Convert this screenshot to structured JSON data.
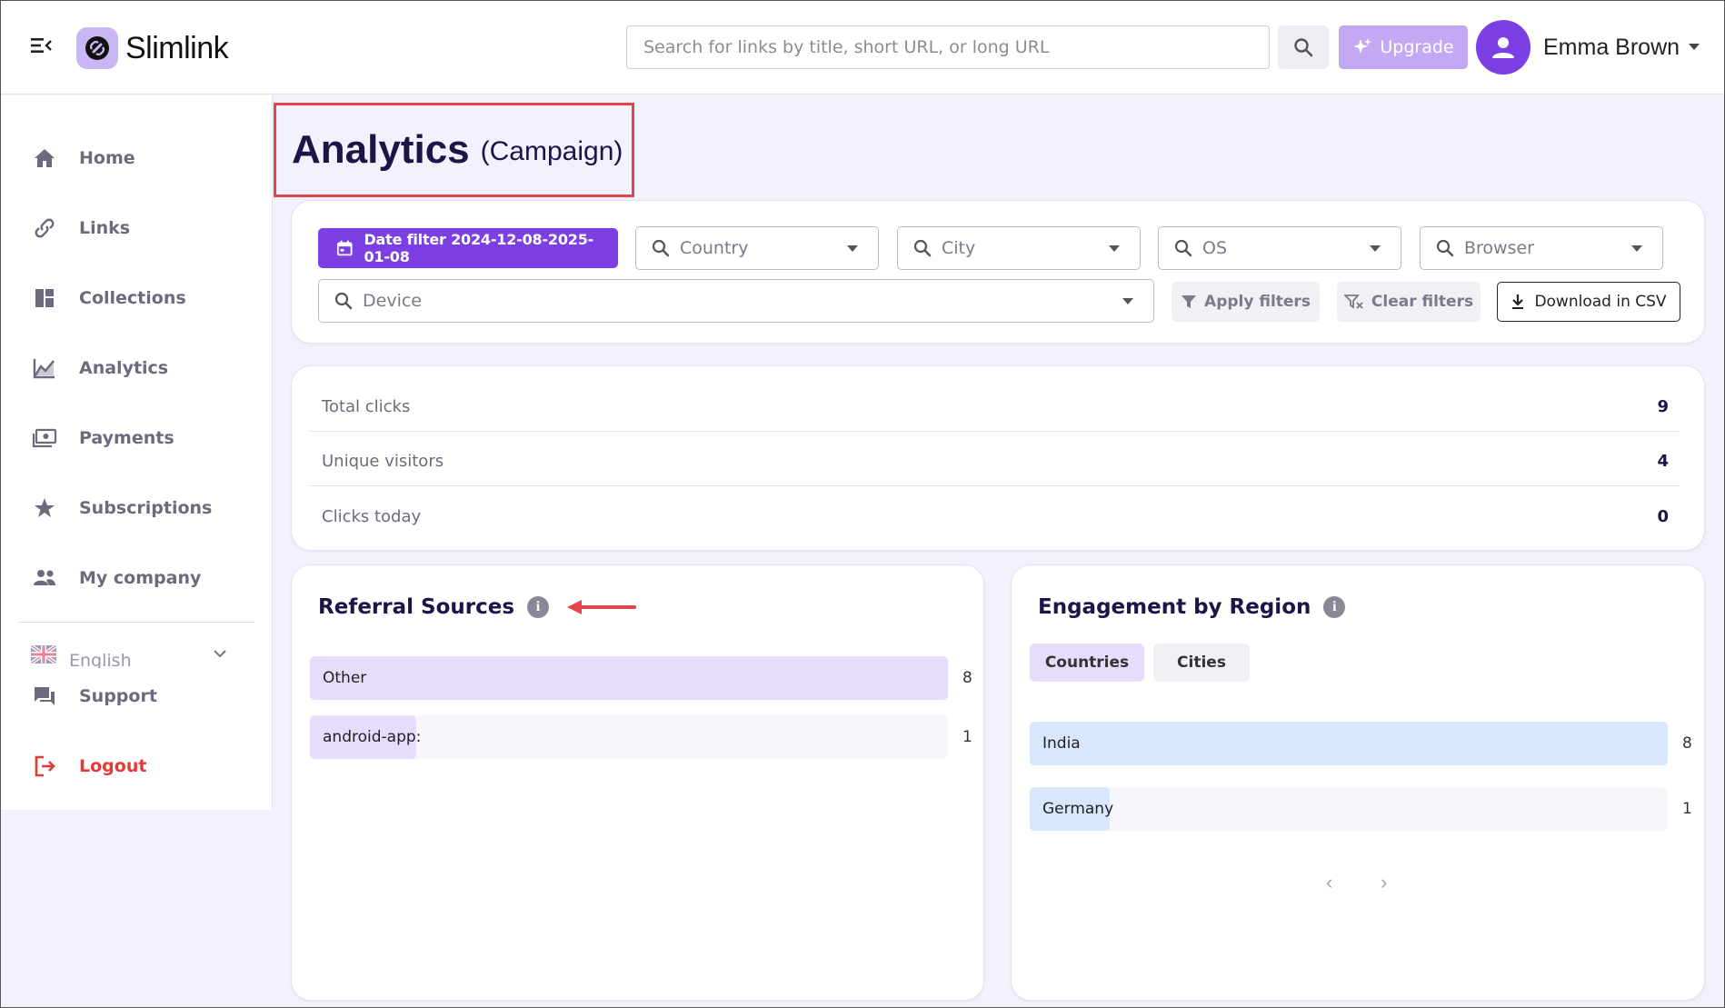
{
  "header": {
    "logo_text": "Slimlink",
    "search_placeholder": "Search for links by title, short URL, or long URL",
    "upgrade_label": "Upgrade",
    "user_name": "Emma Brown"
  },
  "sidebar": {
    "items": [
      {
        "label": "Home",
        "icon": "home-icon"
      },
      {
        "label": "Links",
        "icon": "link-icon"
      },
      {
        "label": "Collections",
        "icon": "dashboard-icon"
      },
      {
        "label": "Analytics",
        "icon": "chart-icon"
      },
      {
        "label": "Payments",
        "icon": "payments-icon"
      },
      {
        "label": "Subscriptions",
        "icon": "star-icon"
      },
      {
        "label": "My company",
        "icon": "people-icon"
      }
    ],
    "language": "English",
    "support_label": "Support",
    "logout_label": "Logout"
  },
  "page": {
    "title": "Analytics",
    "subtitle": "(Campaign)"
  },
  "filters": {
    "date_filter_label": "Date filter 2024-12-08-2025-01-08",
    "country_placeholder": "Country",
    "city_placeholder": "City",
    "os_placeholder": "OS",
    "browser_placeholder": "Browser",
    "device_placeholder": "Device",
    "apply_label": "Apply filters",
    "clear_label": "Clear filters",
    "download_label": "Download in CSV"
  },
  "stats": [
    {
      "label": "Total clicks",
      "value": "9"
    },
    {
      "label": "Unique visitors",
      "value": "4"
    },
    {
      "label": "Clicks today",
      "value": "0"
    }
  ],
  "referral": {
    "title": "Referral Sources",
    "rows": [
      {
        "label": "Other",
        "value": "8",
        "fraction": 1.0
      },
      {
        "label": "android-app:",
        "value": "1",
        "fraction": 0.167
      }
    ]
  },
  "region": {
    "title": "Engagement by Region",
    "tabs": [
      {
        "label": "Countries",
        "active": true
      },
      {
        "label": "Cities",
        "active": false
      }
    ],
    "rows": [
      {
        "label": "India",
        "value": "8",
        "fraction": 1.0
      },
      {
        "label": "Germany",
        "value": "1",
        "fraction": 0.125
      }
    ],
    "prev": "‹",
    "next": "›"
  },
  "colors": {
    "primary": "#7b3fe4",
    "referral_bar": "#e6dcfb",
    "region_bar": "#d9e7fd",
    "annotation_red": "#e0464a",
    "logout_red": "#e53935"
  }
}
